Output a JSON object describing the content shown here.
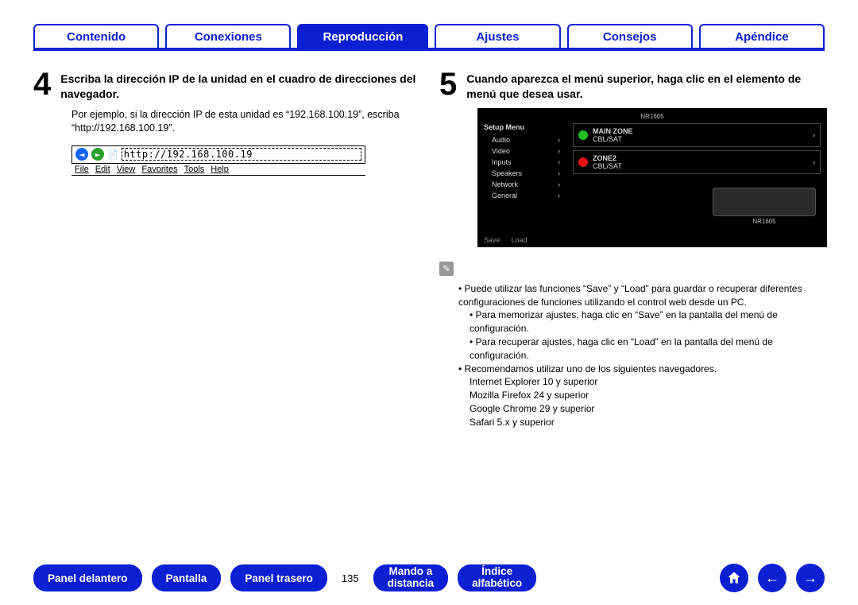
{
  "nav": {
    "tabs": [
      {
        "label": "Contenido"
      },
      {
        "label": "Conexiones"
      },
      {
        "label": "Reproducción",
        "active": true
      },
      {
        "label": "Ajustes"
      },
      {
        "label": "Consejos"
      },
      {
        "label": "Apéndice"
      }
    ]
  },
  "left": {
    "num": "4",
    "title": "Escriba la dirección IP de la unidad en el cuadro de direcciones del navegador.",
    "para": "Por ejemplo, si la dirección IP de esta unidad es “192.168.100.19”, escriba “http://192.168.100.19”.",
    "addr": "http://192.168.100.19",
    "menubar": [
      "File",
      "Edit",
      "View",
      "Favorites",
      "Tools",
      "Help"
    ]
  },
  "right": {
    "num": "5",
    "title": "Cuando aparezca el menú superior, haga clic en el elemento de menú que desea usar.",
    "setup": {
      "brand": "NR1605",
      "menu_title": "Setup Menu",
      "items": [
        "Audio",
        "Video",
        "Inputs",
        "Speakers",
        "Network",
        "General"
      ],
      "zone1_name": "MAIN ZONE",
      "zone1_src": "CBL/SAT",
      "zone2_name": "ZONE2",
      "zone2_src": "CBL/SAT",
      "device_label": "NR1605",
      "save": "Save",
      "load": "Load"
    },
    "notes": {
      "b1": "Puede utilizar las funciones “Save” y “Load” para guardar o recuperar diferentes configuraciones de funciones utilizando el control web desde un PC.",
      "b1a": "Para memorizar ajustes, haga clic en “Save” en la pantalla del menú de configuración.",
      "b1b": "Para recuperar ajustes, haga clic en “Load” en la pantalla del menú de configuración.",
      "b2": "Recomendamos utilizar uno de los siguientes navegadores.",
      "browsers": [
        "Internet Explorer 10 y superior",
        "Mozilla Firefox 24 y superior",
        "Google Chrome 29 y superior",
        "Safari 5.x y superior"
      ]
    }
  },
  "bottom": {
    "panel_delantero": "Panel delantero",
    "pantalla": "Pantalla",
    "panel_trasero": "Panel trasero",
    "page": "135",
    "mando_l1": "Mando a",
    "mando_l2": "distancia",
    "indice_l1": "Índice",
    "indice_l2": "alfabético"
  }
}
